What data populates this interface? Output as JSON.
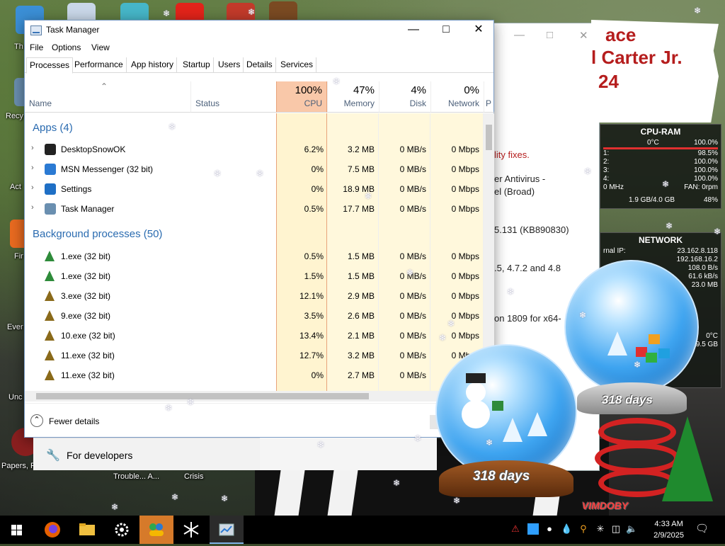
{
  "desktop": {
    "labels": [
      "Th",
      "Recy",
      "Act",
      "Fir",
      "Ever",
      "Unc",
      "Papers, P",
      "Trouble... A...",
      "Crisis"
    ]
  },
  "background_window": {
    "banner": [
      "ace",
      "l Carter Jr.",
      "24"
    ],
    "lines": [
      "lity fixes.",
      "er Antivirus -",
      "el (Broad)",
      "5.131 (KB890830)",
      ".5, 4.7.2 and 4.8",
      "on 1809 for x64-"
    ]
  },
  "gadgets": {
    "cpu": {
      "title": "CPU-RAM",
      "temp": "0°C",
      "total": "100.0%",
      "cores": [
        {
          "label": "1:",
          "value": "98.5%"
        },
        {
          "label": "2:",
          "value": "100.0%"
        },
        {
          "label": "3:",
          "value": "100.0%"
        },
        {
          "label": "4:",
          "value": "100.0%"
        }
      ],
      "freq": "0 MHz",
      "fan": "FAN: 0rpm",
      "ram": "1.9 GB/4.0 GB",
      "ram_pct": "48%"
    },
    "network": {
      "title": "NETWORK",
      "ext_label": "rnal IP:",
      "ext_ip": "23.162.8.118",
      "int_ip": "192.168.16.2",
      "down": "108.0 B/s",
      "up": "61.6 kB/s",
      "total": "23.0 MB",
      "temp": "0°C",
      "disk": "9.5 GB"
    }
  },
  "task_manager": {
    "title": "Task Manager",
    "menu": [
      "File",
      "Options",
      "View"
    ],
    "tabs": [
      "Processes",
      "Performance",
      "App history",
      "Startup",
      "Users",
      "Details",
      "Services"
    ],
    "columns": {
      "name": "Name",
      "status": "Status",
      "cpu_pct": "100%",
      "cpu": "CPU",
      "mem_pct": "47%",
      "mem": "Memory",
      "disk_pct": "4%",
      "disk": "Disk",
      "net_pct": "0%",
      "net": "Network",
      "power": "P"
    },
    "groups": {
      "apps": "Apps (4)",
      "background": "Background processes (50)"
    },
    "apps": [
      {
        "name": "DesktopSnowOK",
        "cpu": "6.2%",
        "mem": "3.2 MB",
        "disk": "0 MB/s",
        "net": "0 Mbps",
        "icon": "snowflake-icon"
      },
      {
        "name": "MSN Messenger (32 bit)",
        "cpu": "0%",
        "mem": "7.5 MB",
        "disk": "0 MB/s",
        "net": "0 Mbps",
        "icon": "msn-icon"
      },
      {
        "name": "Settings",
        "cpu": "0%",
        "mem": "18.9 MB",
        "disk": "0 MB/s",
        "net": "0 Mbps",
        "icon": "gear-icon"
      },
      {
        "name": "Task Manager",
        "cpu": "0.5%",
        "mem": "17.7 MB",
        "disk": "0 MB/s",
        "net": "0 Mbps",
        "icon": "task-manager-icon"
      }
    ],
    "background": [
      {
        "name": "1.exe (32 bit)",
        "cpu": "0.5%",
        "mem": "1.5 MB",
        "disk": "0 MB/s",
        "net": "0 Mbps",
        "icon": "elf-icon"
      },
      {
        "name": "1.exe (32 bit)",
        "cpu": "1.5%",
        "mem": "1.5 MB",
        "disk": "0 MB/s",
        "net": "0 Mbps",
        "icon": "elf-icon"
      },
      {
        "name": "3.exe (32 bit)",
        "cpu": "12.1%",
        "mem": "2.9 MB",
        "disk": "0 MB/s",
        "net": "0 Mbps",
        "icon": "xmas-tree-icon"
      },
      {
        "name": "9.exe (32 bit)",
        "cpu": "3.5%",
        "mem": "2.6 MB",
        "disk": "0 MB/s",
        "net": "0 Mbps",
        "icon": "xmas-tree-icon"
      },
      {
        "name": "10.exe (32 bit)",
        "cpu": "13.4%",
        "mem": "2.1 MB",
        "disk": "0 MB/s",
        "net": "0 Mbps",
        "icon": "xmas-tree-icon"
      },
      {
        "name": "11.exe (32 bit)",
        "cpu": "12.7%",
        "mem": "3.2 MB",
        "disk": "0 MB/s",
        "net": "0 Mbps",
        "icon": "xmas-tree-icon"
      },
      {
        "name": "11.exe (32 bit)",
        "cpu": "0%",
        "mem": "2.7 MB",
        "disk": "0 MB/s",
        "net": "0 Mbps",
        "icon": "xmas-tree-icon"
      }
    ],
    "fewer_details": "Fewer details"
  },
  "settings_strip": {
    "label": "For developers"
  },
  "globes": {
    "days_1": "318 days",
    "days_2": "318 days",
    "brand": "VIMDOBY"
  },
  "taskbar": {
    "time": "4:33 AM",
    "date": "2/9/2025",
    "apps": [
      "start-icon",
      "firefox-icon",
      "file-explorer-icon",
      "settings-gear-icon",
      "msn-icon",
      "snowflake-icon",
      "task-manager-icon"
    ]
  },
  "colors": {
    "accent": "#2a6bb0",
    "cpu_highlight": "#f9c8a9",
    "cell_heat": "#fff4d0",
    "news_red": "#b51d1d"
  }
}
